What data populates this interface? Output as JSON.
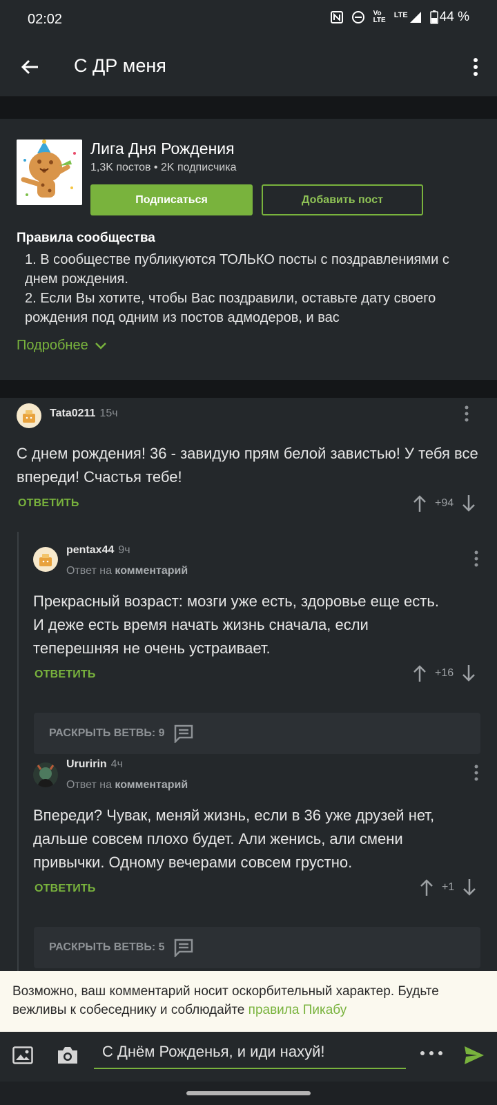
{
  "status": {
    "time": "02:02",
    "battery": "44 %",
    "network": "LTE"
  },
  "appbar": {
    "title": "С ДР меня"
  },
  "community": {
    "name": "Лига Дня Рождения",
    "stats": "1,3K постов • 2K подписчика",
    "subscribe_label": "Подписаться",
    "add_post_label": "Добавить пост",
    "rules_title": "Правила сообщества",
    "rules_text": "1. В сообществе публикуются ТОЛЬКО посты с поздравлениями с днем рождения.\n2. Если Вы хотите, чтобы Вас поздравили, оставьте дату своего рождения под одним из постов адмодеров, и вас",
    "more_label": "Подробнее"
  },
  "comments": [
    {
      "author": "Tata0211",
      "time": "15ч",
      "text": "С днем рождения! 36 - завидую прям белой завистью! У тебя все впереди! Счастья тебе!",
      "reply_label": "ОТВЕТИТЬ",
      "score": "+94"
    },
    {
      "author": "pentax44",
      "time": "9ч",
      "reply_to_prefix": "Ответ на",
      "reply_to": "комментарий",
      "text": "Прекрасный возраст: мозги уже есть, здоровье еще есть. И деже есть время начать жизнь сначала, если теперешняя не очень устраивает.",
      "reply_label": "ОТВЕТИТЬ",
      "score": "+16",
      "expand_label": "РАСКРЫТЬ ВЕТВЬ: 9"
    },
    {
      "author": "Ururirin",
      "time": "4ч",
      "reply_to_prefix": "Ответ на",
      "reply_to": "комментарий",
      "text": "Впереди? Чувак, меняй жизнь, если в 36 уже друзей нет, дальше совсем плохо будет. Али женись, али смени привычки. Одному вечерами совсем грустно.",
      "reply_label": "ОТВЕТИТЬ",
      "score": "+1",
      "expand_label": "РАСКРЫТЬ ВЕТВЬ: 5"
    }
  ],
  "warning": {
    "text": "Возможно, ваш комментарий носит оскорбительный характер. Будьте вежливы к собеседнику и соблюдайте ",
    "link": "правила Пикабу"
  },
  "composer": {
    "value": "С Днём Рожденья, и иди нахуй!"
  },
  "colors": {
    "accent": "#79b33d",
    "background": "#24282b"
  }
}
